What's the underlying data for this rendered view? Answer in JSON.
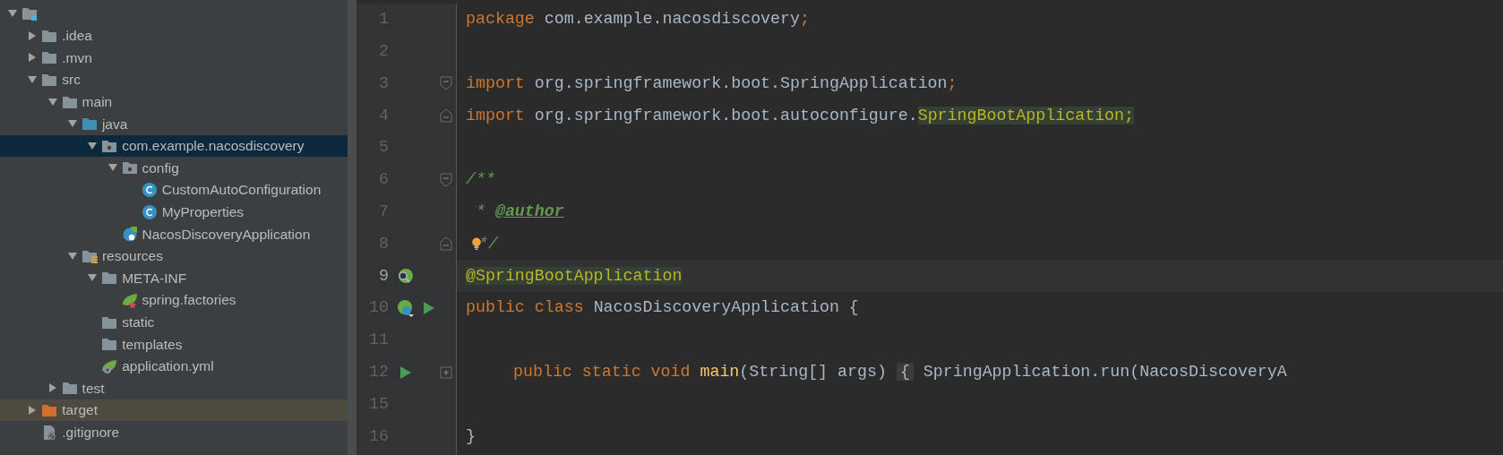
{
  "project_tree": [
    {
      "kind": "module",
      "expanded": true,
      "selected": false,
      "excluded": false,
      "children": [
        {
          "label": ".idea",
          "kind": "folder",
          "expanded": false,
          "selected": false,
          "excluded": false
        },
        {
          "label": ".mvn",
          "kind": "folder",
          "expanded": false,
          "selected": false,
          "excluded": false
        },
        {
          "label": "src",
          "kind": "folder",
          "expanded": true,
          "selected": false,
          "excluded": false,
          "children": [
            {
              "label": "main",
              "kind": "folder",
              "expanded": true,
              "selected": false,
              "excluded": false,
              "children": [
                {
                  "label": "java",
                  "kind": "source-folder",
                  "expanded": true,
                  "selected": false,
                  "excluded": false,
                  "children": [
                    {
                      "label": "com.example.nacosdiscovery",
                      "kind": "package",
                      "expanded": true,
                      "selected": true,
                      "excluded": false,
                      "children": [
                        {
                          "label": "config",
                          "kind": "package",
                          "expanded": true,
                          "selected": false,
                          "excluded": false,
                          "children": [
                            {
                              "label": "CustomAutoConfiguration",
                              "kind": "class",
                              "selected": false,
                              "excluded": false
                            },
                            {
                              "label": "MyProperties",
                              "kind": "class",
                              "selected": false,
                              "excluded": false
                            }
                          ]
                        },
                        {
                          "label": "NacosDiscoveryApplication",
                          "kind": "boot-class",
                          "selected": false,
                          "excluded": false
                        }
                      ]
                    }
                  ]
                },
                {
                  "label": "resources",
                  "kind": "resources-folder",
                  "expanded": true,
                  "selected": false,
                  "excluded": false,
                  "children": [
                    {
                      "label": "META-INF",
                      "kind": "folder",
                      "expanded": true,
                      "selected": false,
                      "excluded": false,
                      "children": [
                        {
                          "label": "spring.factories",
                          "kind": "spring-file",
                          "selected": false,
                          "excluded": false
                        }
                      ]
                    },
                    {
                      "label": "static",
                      "kind": "folder",
                      "selected": false,
                      "excluded": false
                    },
                    {
                      "label": "templates",
                      "kind": "folder",
                      "selected": false,
                      "excluded": false
                    },
                    {
                      "label": "application.yml",
                      "kind": "spring-config",
                      "selected": false,
                      "excluded": false
                    }
                  ]
                }
              ]
            },
            {
              "label": "test",
              "kind": "folder",
              "expanded": false,
              "selected": false,
              "excluded": false
            }
          ]
        },
        {
          "label": "target",
          "kind": "excluded-folder",
          "expanded": false,
          "selected": false,
          "excluded": true
        },
        {
          "label": ".gitignore",
          "kind": "ignore-file",
          "selected": false,
          "excluded": false
        }
      ]
    }
  ],
  "editor_lines": [
    {
      "number": "1",
      "current": false,
      "indented": false,
      "tokens": [
        {
          "text": "package ",
          "kind": "keyword"
        },
        {
          "text": "com.example.nacosdiscovery",
          "kind": "plain"
        },
        {
          "text": ";",
          "kind": "keyword"
        }
      ]
    },
    {
      "number": "2",
      "current": false
    },
    {
      "number": "3",
      "current": false,
      "indented": false,
      "fold_marker": {
        "kind": "start"
      },
      "tokens": [
        {
          "text": "import ",
          "kind": "keyword"
        },
        {
          "text": "org.springframework.boot.SpringApplication",
          "kind": "plain"
        },
        {
          "text": ";",
          "kind": "keyword"
        }
      ]
    },
    {
      "number": "4",
      "current": false,
      "indented": false,
      "fold_marker": {
        "kind": "end"
      },
      "tokens": [
        {
          "text": "import ",
          "kind": "keyword"
        },
        {
          "text": "org.springframework.boot.autoconfigure.",
          "kind": "plain"
        },
        {
          "text": "SpringBootApplication;",
          "kind": "usage"
        }
      ]
    },
    {
      "number": "5",
      "current": false
    },
    {
      "number": "6",
      "current": false,
      "indented": false,
      "fold_marker": {
        "kind": "start"
      },
      "tokens": [
        {
          "text": "/**",
          "kind": "comment"
        }
      ]
    },
    {
      "number": "7",
      "current": false,
      "indented": false,
      "tokens": [
        {
          "text": " * ",
          "kind": "comment"
        },
        {
          "text": "@author",
          "kind": "doctag"
        }
      ]
    },
    {
      "number": "8",
      "current": false,
      "indented": false,
      "fold_marker": {
        "kind": "end"
      },
      "inline_icons": [
        {
          "kind": "bulb"
        }
      ],
      "tokens": [
        {
          "text": "*/",
          "kind": "comment"
        }
      ]
    },
    {
      "number": "9",
      "current": true,
      "indented": false,
      "gutter_icons": [
        {
          "kind": "bean-search"
        }
      ],
      "tokens": [
        {
          "text": "@SpringBootApplication",
          "kind": "annotation"
        }
      ]
    },
    {
      "number": "10",
      "current": false,
      "indented": false,
      "gutter_icons": [
        {
          "kind": "bean-class"
        },
        {
          "kind": "run"
        }
      ],
      "tokens": [
        {
          "text": "public class ",
          "kind": "keyword"
        },
        {
          "text": "NacosDiscoveryApplication",
          "kind": "plain"
        },
        {
          "text": " {",
          "kind": "plain"
        }
      ]
    },
    {
      "number": "11",
      "current": false
    },
    {
      "number": "12",
      "current": false,
      "indented": true,
      "gutter_icons": [
        {
          "kind": "run"
        }
      ],
      "fold_marker": {
        "kind": "collapsed"
      },
      "tokens": [
        {
          "text": "public static void ",
          "kind": "keyword"
        },
        {
          "text": "main",
          "kind": "method"
        },
        {
          "text": "(String[] args) ",
          "kind": "plain"
        },
        {
          "text": "{",
          "kind": "folded"
        },
        {
          "text": " SpringApplication.run(NacosDiscoveryA",
          "kind": "plain"
        }
      ]
    },
    {
      "number": "15",
      "current": false
    },
    {
      "number": "16",
      "current": false,
      "indented": false,
      "tokens": [
        {
          "text": "}",
          "kind": "plain"
        }
      ]
    }
  ]
}
